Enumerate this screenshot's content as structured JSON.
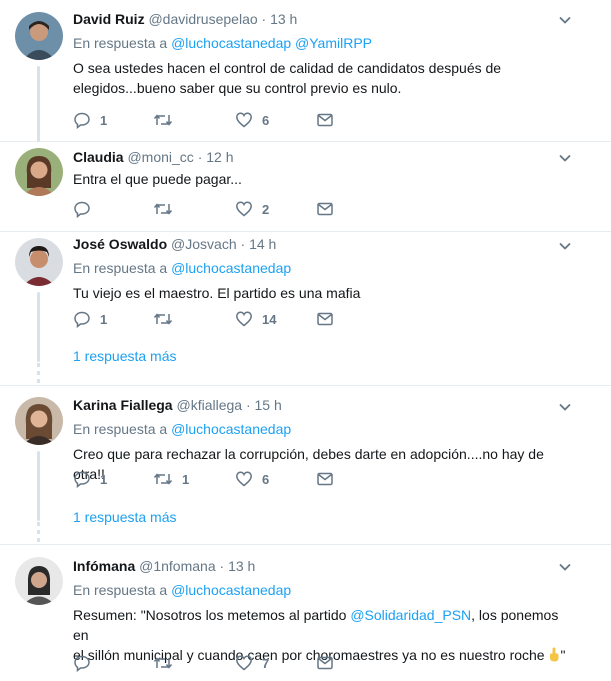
{
  "tweets": [
    {
      "name": "David Ruiz",
      "handle": "@davidrusepelao",
      "time": "13 h",
      "reply_prefix": "En respuesta a",
      "reply_mentions": [
        "@luchocastanedap",
        "@YamilRPP"
      ],
      "text_lines": [
        "O sea ustedes hacen el control de calidad de candidatos después de",
        "elegidos...bueno saber que su control previo es nulo."
      ],
      "counts": {
        "replies": "1",
        "retweets": "",
        "likes": "6"
      },
      "avatar_colors": {
        "bg": "#6e8fa8",
        "face": "#c99a7c",
        "hair": "#2b241f",
        "shirt": "#3a4b5c"
      }
    },
    {
      "name": "Claudia",
      "handle": "@moni_cc",
      "time": "12 h",
      "text_lines": [
        "Entra el que puede pagar..."
      ],
      "counts": {
        "replies": "",
        "retweets": "",
        "likes": "2"
      },
      "avatar_colors": {
        "bg": "#9ab07a",
        "face": "#d9a98a",
        "hair": "#5a3a26",
        "shirt": "#b07a5a"
      }
    },
    {
      "name": "José Oswaldo",
      "handle": "@Josvach",
      "time": "14 h",
      "reply_prefix": "En respuesta a",
      "reply_mentions": [
        "@luchocastanedap"
      ],
      "text_lines": [
        "Tu viejo es el maestro. El partido es una mafia"
      ],
      "counts": {
        "replies": "1",
        "retweets": "",
        "likes": "14"
      },
      "more_replies": "1 respuesta más",
      "avatar_colors": {
        "bg": "#d9dde2",
        "face": "#c78e6e",
        "hair": "#1f1a17",
        "shirt": "#7a2c33"
      }
    },
    {
      "name": "Karina Fiallega",
      "handle": "@kfiallega",
      "time": "15 h",
      "reply_prefix": "En respuesta a",
      "reply_mentions": [
        "@luchocastanedap"
      ],
      "text_lines": [
        "Creo que para rechazar la corrupción, debes darte en adopción....no hay de otra!!"
      ],
      "counts": {
        "replies": "1",
        "retweets": "1",
        "likes": "6"
      },
      "more_replies": "1 respuesta más",
      "avatar_colors": {
        "bg": "#c8b9a8",
        "face": "#e0b497",
        "hair": "#6a4a32",
        "shirt": "#3a2d28"
      }
    },
    {
      "name": "Infómana",
      "handle": "@1nfomana",
      "time": "13 h",
      "reply_prefix": "En respuesta a",
      "reply_mentions": [
        "@luchocastanedap"
      ],
      "text_before": "Resumen: \"Nosotros los metemos al partido ",
      "text_mention": "@Solidaridad_PSN",
      "text_after": ", los ponemos en",
      "text_line2": "el sillón municipal y cuando caen por choromaestres ya no es nuestro roche",
      "text_end": "\"",
      "counts": {
        "replies": "",
        "retweets": "",
        "likes": "7"
      },
      "avatar_colors": {
        "bg": "#e8e8e8",
        "face": "#cfa58c",
        "hair": "#2a2a2a",
        "shirt": "#555555"
      }
    }
  ],
  "dot": "·"
}
